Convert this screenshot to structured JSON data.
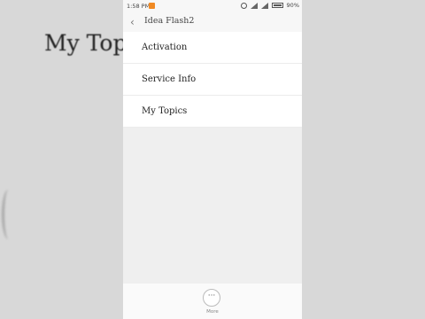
{
  "background": {
    "title": "My Topics"
  },
  "statusbar": {
    "time": "1:58 PM",
    "battery": "90%"
  },
  "header": {
    "back_icon": "‹",
    "title": "Idea Flash2"
  },
  "menu": {
    "items": [
      {
        "label": "Activation"
      },
      {
        "label": "Service Info"
      },
      {
        "label": "My Topics"
      }
    ]
  },
  "footer": {
    "more_icon": "···",
    "more_label": "More"
  }
}
